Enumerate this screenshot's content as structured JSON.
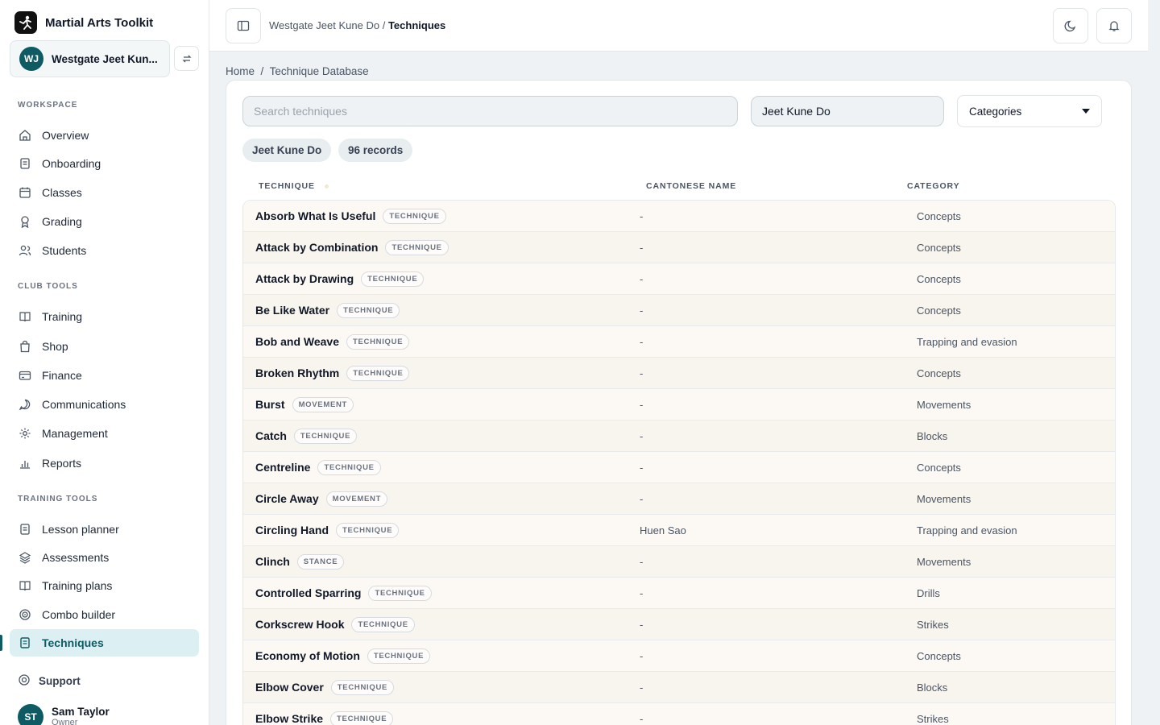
{
  "app": {
    "name": "Martial Arts Toolkit"
  },
  "club": {
    "initials": "WJ",
    "name": "Westgate Jeet Kun..."
  },
  "sidebar": {
    "workspace_label": "WORKSPACE",
    "workspace": [
      {
        "label": "Overview"
      },
      {
        "label": "Onboarding"
      },
      {
        "label": "Classes"
      },
      {
        "label": "Grading"
      },
      {
        "label": "Students"
      }
    ],
    "club_tools_label": "CLUB TOOLS",
    "club_tools": [
      {
        "label": "Training"
      },
      {
        "label": "Shop"
      },
      {
        "label": "Finance"
      },
      {
        "label": "Communications"
      },
      {
        "label": "Management"
      },
      {
        "label": "Reports"
      }
    ],
    "training_tools_label": "TRAINING TOOLS",
    "training_tools": [
      {
        "label": "Lesson planner"
      },
      {
        "label": "Assessments"
      },
      {
        "label": "Training plans"
      },
      {
        "label": "Combo builder"
      },
      {
        "label": "Techniques"
      }
    ],
    "support": "Support",
    "user": {
      "initials": "ST",
      "name": "Sam Taylor",
      "role": "Owner"
    }
  },
  "topbar": {
    "club": "Westgate Jeet Kune Do",
    "separator": "/",
    "page": "Techniques"
  },
  "breadcrumb": {
    "home": "Home",
    "separator": "/",
    "current": "Technique Database"
  },
  "filters": {
    "search_placeholder": "Search techniques",
    "style": "Jeet Kune Do",
    "categories": "Categories"
  },
  "chips": {
    "style": "Jeet Kune Do",
    "records": "96 records"
  },
  "table": {
    "headers": {
      "technique": "TECHNIQUE",
      "cantonese": "CANTONESE NAME",
      "category": "CATEGORY"
    },
    "rows": [
      {
        "name": "Absorb What Is Useful",
        "type": "TECHNIQUE",
        "cantonese": "-",
        "category": "Concepts"
      },
      {
        "name": "Attack by Combination",
        "type": "TECHNIQUE",
        "cantonese": "-",
        "category": "Concepts"
      },
      {
        "name": "Attack by Drawing",
        "type": "TECHNIQUE",
        "cantonese": "-",
        "category": "Concepts"
      },
      {
        "name": "Be Like Water",
        "type": "TECHNIQUE",
        "cantonese": "-",
        "category": "Concepts"
      },
      {
        "name": "Bob and Weave",
        "type": "TECHNIQUE",
        "cantonese": "-",
        "category": "Trapping and evasion"
      },
      {
        "name": "Broken Rhythm",
        "type": "TECHNIQUE",
        "cantonese": "-",
        "category": "Concepts"
      },
      {
        "name": "Burst",
        "type": "MOVEMENT",
        "cantonese": "-",
        "category": "Movements"
      },
      {
        "name": "Catch",
        "type": "TECHNIQUE",
        "cantonese": "-",
        "category": "Blocks"
      },
      {
        "name": "Centreline",
        "type": "TECHNIQUE",
        "cantonese": "-",
        "category": "Concepts"
      },
      {
        "name": "Circle Away",
        "type": "MOVEMENT",
        "cantonese": "-",
        "category": "Movements"
      },
      {
        "name": "Circling Hand",
        "type": "TECHNIQUE",
        "cantonese": "Huen Sao",
        "category": "Trapping and evasion"
      },
      {
        "name": "Clinch",
        "type": "STANCE",
        "cantonese": "-",
        "category": "Movements"
      },
      {
        "name": "Controlled Sparring",
        "type": "TECHNIQUE",
        "cantonese": "-",
        "category": "Drills"
      },
      {
        "name": "Corkscrew Hook",
        "type": "TECHNIQUE",
        "cantonese": "-",
        "category": "Strikes"
      },
      {
        "name": "Economy of Motion",
        "type": "TECHNIQUE",
        "cantonese": "-",
        "category": "Concepts"
      },
      {
        "name": "Elbow Cover",
        "type": "TECHNIQUE",
        "cantonese": "-",
        "category": "Blocks"
      },
      {
        "name": "Elbow Strike",
        "type": "TECHNIQUE",
        "cantonese": "-",
        "category": "Strikes"
      }
    ]
  }
}
